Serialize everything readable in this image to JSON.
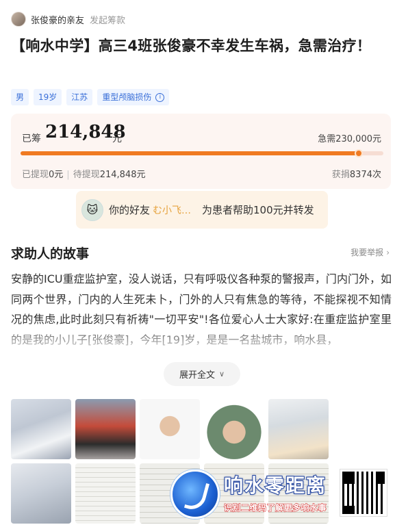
{
  "header": {
    "author": "张俊豪的亲友",
    "start_link": "发起筹款"
  },
  "title": "【响水中学】高三4班张俊豪不幸发生车祸，急需治疗！",
  "tags": [
    "男",
    "19岁",
    "江苏",
    "重型颅脑损伤"
  ],
  "funding": {
    "raised_label": "已筹",
    "raised_amount": "214,848",
    "unit": "元",
    "target_text": "急需230,000元",
    "progress_fraction": 0.934,
    "withdrawn_label": "已提现",
    "withdrawn_value": "0元",
    "pending_label": "待提现",
    "pending_value": "214,848元",
    "donations_label": "获捐",
    "donations_value": "8374次"
  },
  "friend": {
    "prefix": "你的好友",
    "name": "む小飞…",
    "action": "为患者帮助100元并转发"
  },
  "story": {
    "heading": "求助人的故事",
    "report": "我要举报",
    "text": "安静的ICU重症监护室，没人说话，只有呼吸仪各种泵的警报声，门内门外，如同两个世界，门内的人生死未卜，门外的人只有焦急的等待，不能探视不知情况的焦虑,此时此刻只有祈祷\"一切平安\"!各位爱心人士大家好:在重症监护室里的是我的小儿子[张俊豪]，今年[19]岁，是是一名盐城市，响水县，",
    "expand": "展开全文"
  },
  "watermark": {
    "title": "响水零距离",
    "subtitle": "识别二维码了解更多响水事"
  },
  "colors": {
    "accent": "#f07a22",
    "tag_text": "#3a6fd8",
    "tag_bg": "#eef4ff",
    "card_bg": "#fdf5f2",
    "friend_bg": "#fdf3e6"
  }
}
